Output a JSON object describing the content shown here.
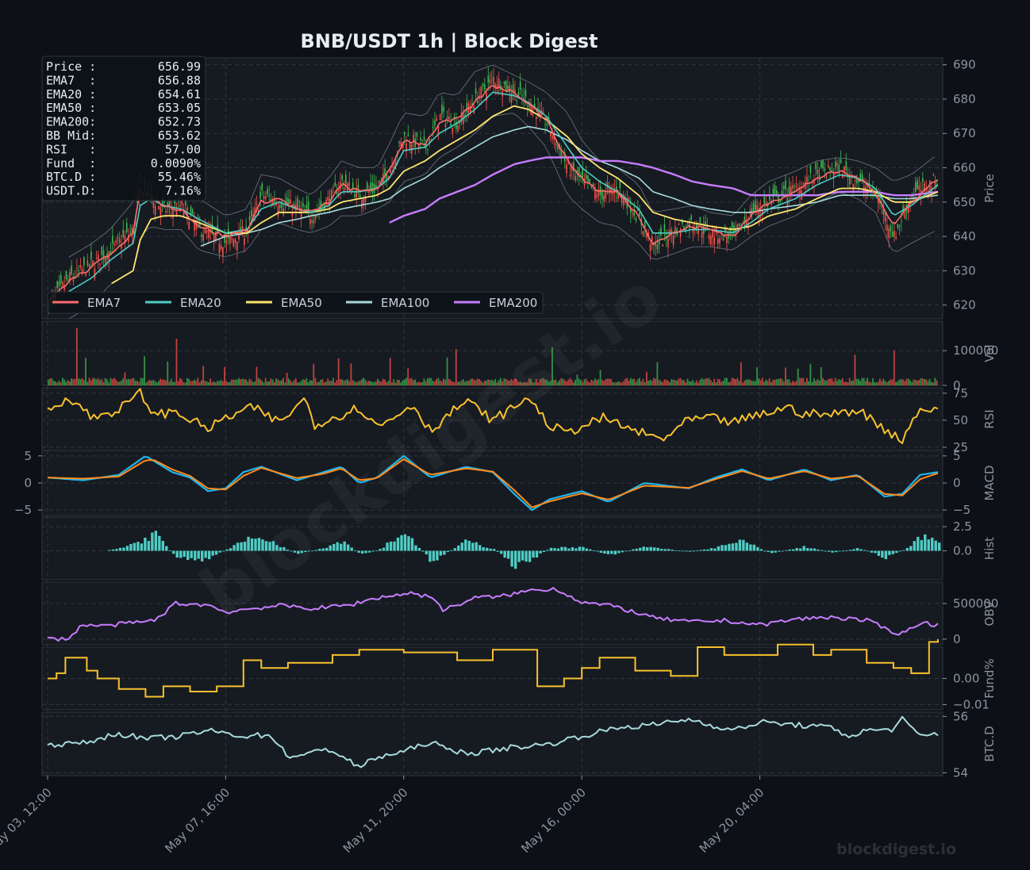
{
  "title": "BNB/USDT  1h  |  Block Digest",
  "watermark": "blockdigest.io",
  "footer": "blockdigest.io",
  "colors": {
    "background": "#0d1117",
    "panel": "#161b22",
    "grid": "#30363d",
    "up": "#3fb950",
    "down": "#f85149",
    "ema7": "#ff6b6b",
    "ema20": "#4ecdc4",
    "ema50": "#ffe66d",
    "ema100": "#a8dadc",
    "ema200": "#c77dff",
    "rsi": "#f9c12e",
    "macd": "#1fb6ef",
    "signal": "#ff8c1a",
    "hist": "#4ecdc4",
    "obv": "#c77dff",
    "fund": "#f9c12e",
    "btcd": "#a8dadc"
  },
  "info_box": [
    {
      "label": "Price :",
      "value": "656.99"
    },
    {
      "label": "EMA7  :",
      "value": "656.88"
    },
    {
      "label": "EMA20 :",
      "value": "654.61"
    },
    {
      "label": "EMA50 :",
      "value": "653.05"
    },
    {
      "label": "EMA200:",
      "value": "652.73"
    },
    {
      "label": "BB Mid:",
      "value": "653.62"
    },
    {
      "label": "RSI   :",
      "value": "57.00"
    },
    {
      "label": "Fund  :",
      "value": "0.0090%"
    },
    {
      "label": "BTC.D :",
      "value": "55.46%"
    },
    {
      "label": "USDT.D:",
      "value": "7.16%"
    }
  ],
  "chart_data": {
    "type": "line",
    "x_ticks": [
      "May 03, 12:00",
      "May 07, 16:00",
      "May 11, 20:00",
      "May 16, 00:00",
      "May 20, 04:00"
    ],
    "legend": [
      "EMA7",
      "EMA20",
      "EMA50",
      "EMA100",
      "EMA200"
    ],
    "panels": [
      {
        "id": "price",
        "ylabel": "Price",
        "ylim": [
          616,
          692
        ],
        "yticks": [
          620,
          630,
          640,
          650,
          660,
          670,
          680,
          690
        ],
        "tick_labels": [
          "620",
          "630",
          "640",
          "650",
          "660",
          "670",
          "680",
          "690"
        ]
      },
      {
        "id": "vol",
        "ylabel": "Vol",
        "ylim": [
          0,
          185000
        ],
        "yticks": [
          0,
          100000
        ],
        "tick_labels": [
          "0",
          "100000"
        ]
      },
      {
        "id": "rsi",
        "ylabel": "RSI",
        "ylim": [
          22,
          80
        ],
        "yticks": [
          25,
          50,
          75
        ],
        "tick_labels": [
          "25",
          "50",
          "75"
        ]
      },
      {
        "id": "macd",
        "ylabel": "MACD",
        "ylim": [
          -6,
          6
        ],
        "yticks": [
          -5,
          0,
          5
        ],
        "tick_labels": [
          "−5",
          "0",
          "5"
        ],
        "left_tick_labels": [
          "−5",
          "0",
          "5"
        ]
      },
      {
        "id": "hist",
        "ylabel": "Hist",
        "ylim": [
          -3,
          3.5
        ],
        "yticks": [
          0,
          2.5
        ],
        "tick_labels": [
          "0.0",
          "2.5"
        ]
      },
      {
        "id": "obv",
        "ylabel": "OBV",
        "ylim": [
          -80000,
          800000
        ],
        "yticks": [
          0,
          500000
        ],
        "tick_labels": [
          "0",
          "500000"
        ]
      },
      {
        "id": "fund",
        "ylabel": "Fund%",
        "ylim": [
          -0.012,
          0.012
        ],
        "yticks": [
          0.0,
          -0.01
        ],
        "tick_labels": [
          "0.00",
          "−0.01"
        ]
      },
      {
        "id": "btcd",
        "ylabel": "BTC.D",
        "ylim": [
          53.9,
          56.15
        ],
        "yticks": [
          54,
          56
        ],
        "tick_labels": [
          "54",
          "56"
        ]
      }
    ],
    "price_series": {
      "x": [
        0,
        12,
        25,
        35,
        48,
        52,
        58,
        65,
        75,
        85,
        100,
        112,
        120,
        130,
        140,
        148,
        158,
        165,
        175,
        185,
        192,
        200,
        212,
        220,
        230,
        240,
        250,
        262,
        270,
        280,
        292,
        300,
        310,
        320,
        332,
        340,
        352,
        362,
        372,
        385,
        395,
        405,
        420,
        432,
        445,
        455,
        465,
        475,
        485,
        500
      ],
      "price": [
        620,
        628,
        632,
        636,
        642,
        655,
        651,
        648,
        649,
        642,
        638,
        642,
        652,
        650,
        648,
        646,
        651,
        656,
        652,
        654,
        660,
        669,
        666,
        675,
        673,
        680,
        686,
        682,
        679,
        673,
        660,
        656,
        652,
        654,
        645,
        637,
        642,
        644,
        641,
        640,
        647,
        650,
        654,
        658,
        660,
        656,
        652,
        640,
        652,
        657
      ],
      "ema7": [
        621,
        627,
        631,
        635,
        641,
        653,
        652,
        649,
        648,
        643,
        640,
        642,
        650,
        651,
        648,
        647,
        650,
        655,
        653,
        654,
        659,
        668,
        667,
        673,
        674,
        679,
        684,
        682,
        679,
        674,
        662,
        657,
        653,
        653,
        646,
        638,
        641,
        643,
        642,
        640,
        646,
        650,
        653,
        657,
        659,
        657,
        653,
        643,
        650,
        657
      ],
      "ema20": [
        null,
        624,
        628,
        633,
        638,
        649,
        651,
        649,
        648,
        645,
        641,
        642,
        648,
        650,
        648,
        647,
        649,
        653,
        653,
        654,
        657,
        665,
        666,
        670,
        673,
        677,
        682,
        681,
        679,
        675,
        666,
        660,
        656,
        653,
        648,
        641,
        641,
        642,
        642,
        641,
        644,
        648,
        651,
        655,
        658,
        657,
        654,
        646,
        649,
        655
      ],
      "ema50": [
        null,
        null,
        null,
        626,
        630,
        639,
        645,
        646,
        646,
        644,
        641,
        641,
        644,
        647,
        647,
        647,
        648,
        650,
        651,
        652,
        654,
        659,
        662,
        665,
        668,
        671,
        675,
        678,
        677,
        674,
        669,
        664,
        660,
        657,
        652,
        647,
        645,
        644,
        643,
        642,
        643,
        646,
        648,
        651,
        654,
        654,
        653,
        650,
        650,
        653
      ],
      "ema100": [
        null,
        null,
        null,
        null,
        null,
        null,
        null,
        null,
        null,
        637,
        640,
        641,
        642,
        644,
        645,
        646,
        647,
        648,
        649,
        650,
        651,
        654,
        657,
        660,
        663,
        666,
        669,
        671,
        672,
        671,
        668,
        665,
        662,
        660,
        657,
        653,
        651,
        649,
        648,
        647,
        647,
        648,
        649,
        650,
        652,
        652,
        652,
        651,
        651,
        652
      ],
      "ema200": [
        null,
        null,
        null,
        null,
        null,
        null,
        null,
        null,
        null,
        null,
        null,
        null,
        null,
        null,
        null,
        null,
        null,
        null,
        null,
        null,
        644,
        646,
        648,
        651,
        653,
        655,
        658,
        661,
        662,
        663,
        663,
        663,
        662,
        662,
        661,
        660,
        658,
        656,
        655,
        654,
        652,
        652,
        652,
        652,
        653,
        653,
        653,
        652,
        652,
        653
      ],
      "bb_upper": [
        null,
        634,
        638,
        642,
        650,
        660,
        661,
        655,
        654,
        651,
        646,
        648,
        658,
        657,
        654,
        652,
        657,
        662,
        660,
        660,
        667,
        676,
        675,
        682,
        681,
        688,
        690,
        687,
        685,
        682,
        676,
        668,
        662,
        660,
        655,
        647,
        648,
        649,
        647,
        646,
        652,
        656,
        659,
        662,
        663,
        662,
        660,
        656,
        658,
        664
      ],
      "bb_lower": [
        null,
        616,
        620,
        626,
        630,
        640,
        643,
        642,
        642,
        636,
        634,
        636,
        642,
        644,
        642,
        641,
        643,
        646,
        646,
        648,
        650,
        656,
        658,
        663,
        666,
        670,
        675,
        676,
        672,
        666,
        652,
        648,
        644,
        643,
        638,
        633,
        635,
        637,
        637,
        636,
        640,
        643,
        646,
        650,
        653,
        651,
        647,
        635,
        638,
        642
      ]
    },
    "rsi": {
      "x": [
        0,
        12,
        25,
        40,
        52,
        60,
        72,
        90,
        100,
        115,
        130,
        145,
        150,
        160,
        175,
        185,
        192,
        205,
        215,
        225,
        235,
        250,
        262,
        270,
        280,
        290,
        300,
        312,
        330,
        345,
        360,
        372,
        385,
        400,
        415,
        425,
        440,
        455,
        470,
        480,
        490,
        500
      ],
      "values": [
        58,
        72,
        52,
        60,
        75,
        55,
        58,
        42,
        52,
        62,
        48,
        70,
        46,
        52,
        62,
        44,
        50,
        65,
        40,
        55,
        68,
        50,
        62,
        72,
        48,
        38,
        44,
        52,
        40,
        32,
        50,
        52,
        48,
        55,
        62,
        56,
        55,
        60,
        42,
        32,
        62,
        57
      ]
    },
    "macd": {
      "x": [
        0,
        20,
        40,
        55,
        60,
        70,
        80,
        90,
        100,
        110,
        120,
        140,
        155,
        165,
        175,
        185,
        200,
        215,
        235,
        250,
        262,
        272,
        282,
        300,
        315,
        335,
        360,
        375,
        390,
        405,
        425,
        440,
        455,
        470,
        480,
        490,
        500
      ],
      "values": [
        1,
        0.5,
        1.5,
        5,
        4,
        2,
        1,
        -1.5,
        -1,
        2,
        3,
        0.5,
        2,
        3,
        0,
        1,
        5,
        1,
        3,
        2,
        -2,
        -5,
        -3,
        -1.5,
        -3.5,
        0,
        -1,
        1,
        2.5,
        0.5,
        2.5,
        0.5,
        1.5,
        -2.5,
        -2,
        1.5,
        2
      ],
      "signal": [
        1,
        0.8,
        1.2,
        4.2,
        4.2,
        2.5,
        1.3,
        -1,
        -1.2,
        1.3,
        2.8,
        0.9,
        1.7,
        2.7,
        0.5,
        0.9,
        4.4,
        1.5,
        2.7,
        2.1,
        -1.3,
        -4.5,
        -3.4,
        -1.9,
        -3.1,
        -0.5,
        -0.9,
        0.7,
        2.2,
        0.8,
        2.2,
        0.8,
        1.3,
        -2,
        -2.3,
        0.7,
        1.8
      ]
    },
    "hist": {
      "x": [
        0,
        20,
        40,
        55,
        60,
        70,
        80,
        90,
        100,
        110,
        120,
        140,
        155,
        165,
        175,
        185,
        200,
        215,
        235,
        250,
        262,
        272,
        282,
        300,
        315,
        335,
        360,
        375,
        390,
        405,
        425,
        440,
        455,
        470,
        480,
        490,
        500
      ],
      "values": [
        0,
        -0.3,
        0.3,
        1.5,
        2.2,
        -0.5,
        -1.2,
        -1.0,
        0.2,
        1.3,
        1.6,
        -0.4,
        0.4,
        1.3,
        -0.5,
        0.1,
        2.3,
        -1.3,
        1.2,
        0.2,
        -1.9,
        -0.9,
        0.4,
        0.4,
        -0.5,
        0.5,
        -0.1,
        0.4,
        1.2,
        -0.3,
        0.5,
        -0.2,
        0.3,
        -0.8,
        0.1,
        1.8,
        1.0
      ]
    },
    "obv": {
      "x": [
        0,
        12,
        20,
        30,
        60,
        72,
        90,
        100,
        115,
        130,
        150,
        170,
        185,
        205,
        218,
        222,
        240,
        255,
        270,
        285,
        300,
        320,
        340,
        360,
        380,
        400,
        420,
        440,
        460,
        475,
        480,
        490,
        500
      ],
      "values": [
        0,
        10000,
        210000,
        180000,
        260000,
        500000,
        480000,
        380000,
        430000,
        470000,
        430000,
        480000,
        580000,
        650000,
        560000,
        400000,
        580000,
        600000,
        680000,
        710000,
        520000,
        450000,
        300000,
        240000,
        260000,
        200000,
        280000,
        310000,
        260000,
        100000,
        80000,
        230000,
        200000
      ]
    },
    "fund": {
      "x": [
        0,
        5,
        10,
        22,
        28,
        40,
        55,
        65,
        80,
        95,
        110,
        120,
        135,
        160,
        175,
        200,
        230,
        250,
        275,
        290,
        300,
        310,
        330,
        350,
        365,
        380,
        410,
        430,
        440,
        460,
        475,
        485,
        495,
        500
      ],
      "values": [
        0.0,
        0.002,
        0.008,
        0.003,
        0.0,
        -0.004,
        -0.007,
        -0.003,
        -0.005,
        -0.003,
        0.007,
        0.004,
        0.006,
        0.009,
        0.011,
        0.01,
        0.007,
        0.011,
        -0.003,
        0.0,
        0.004,
        0.008,
        0.003,
        0.001,
        0.012,
        0.009,
        0.013,
        0.009,
        0.011,
        0.006,
        0.004,
        0.002,
        0.014,
        0.015
      ]
    },
    "btcd": {
      "x": [
        0,
        20,
        40,
        55,
        75,
        90,
        110,
        125,
        135,
        145,
        155,
        165,
        172,
        175,
        185,
        200,
        215,
        225,
        240,
        260,
        280,
        300,
        320,
        340,
        360,
        385,
        400,
        420,
        440,
        450,
        460,
        475,
        480,
        490,
        500
      ],
      "values": [
        55.0,
        55.05,
        55.4,
        55.2,
        55.3,
        55.5,
        55.3,
        55.35,
        54.6,
        54.6,
        54.9,
        54.6,
        54.3,
        54.2,
        54.55,
        54.75,
        55.1,
        54.8,
        54.7,
        54.9,
        55.0,
        55.3,
        55.6,
        55.7,
        55.9,
        55.5,
        55.8,
        55.7,
        55.6,
        55.3,
        55.5,
        55.55,
        55.9,
        55.3,
        55.4
      ]
    }
  }
}
